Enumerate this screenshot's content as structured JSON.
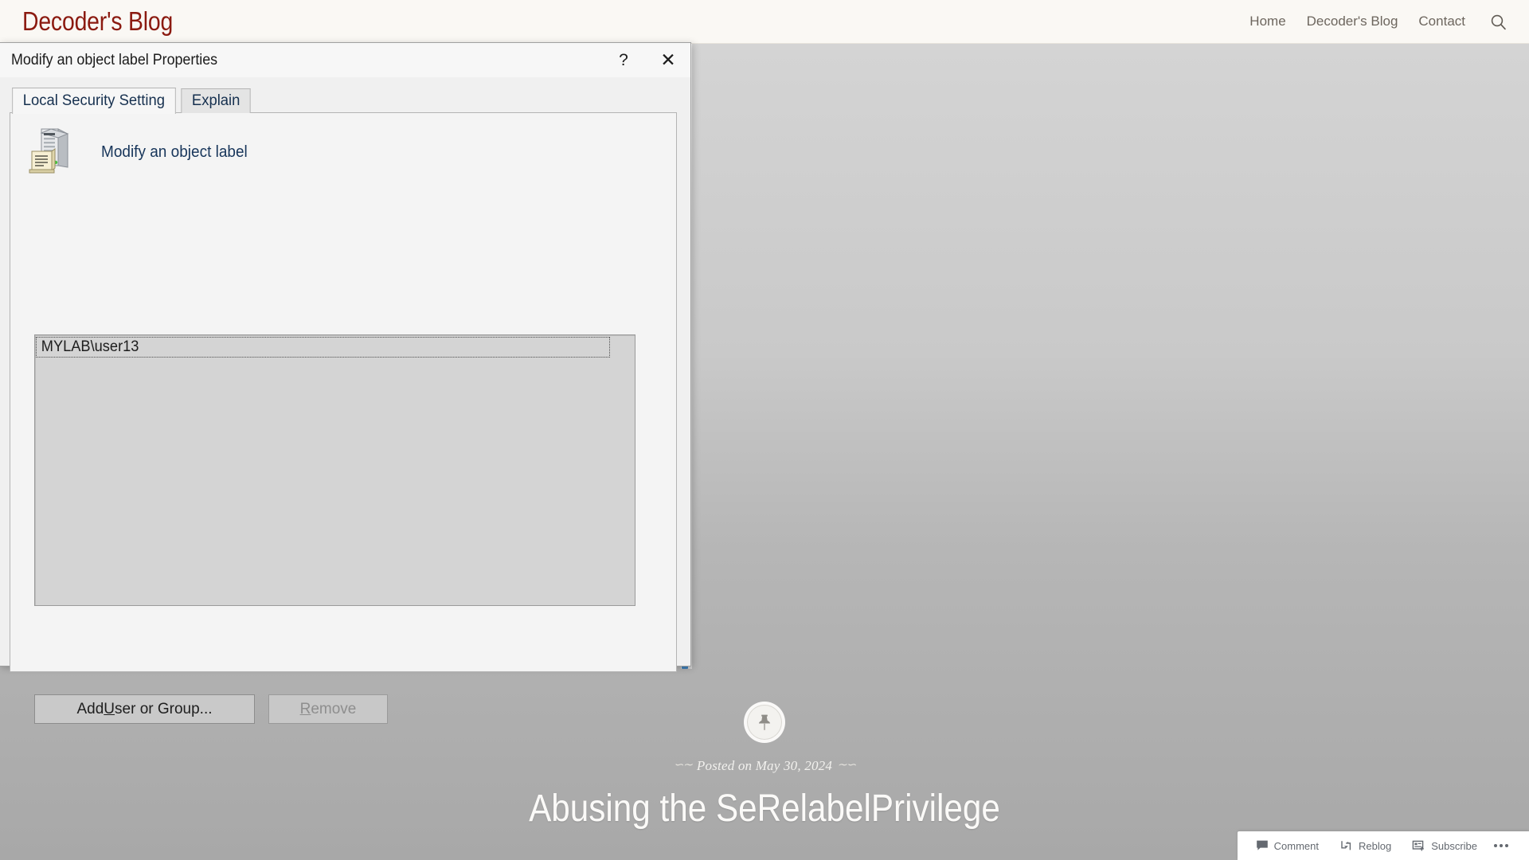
{
  "site": {
    "title": "Decoder's Blog",
    "brand_color": "#8b1a10",
    "nav": [
      {
        "label": "Home",
        "name": "nav-home"
      },
      {
        "label": "Decoder's Blog",
        "name": "nav-decoders-blog"
      },
      {
        "label": "Contact",
        "name": "nav-contact"
      }
    ],
    "search_icon": "search-icon"
  },
  "post": {
    "badge_icon": "pin-icon",
    "date_prefix": "Posted on",
    "date": "May 30, 2024",
    "date_full": "Posted on May 30, 2024",
    "title": "Abusing the SeRelabelPrivilege"
  },
  "actionbar": {
    "items": [
      {
        "label": "Comment",
        "icon": "comment-icon",
        "name": "comment-button"
      },
      {
        "label": "Reblog",
        "icon": "reblog-icon",
        "name": "reblog-button"
      },
      {
        "label": "Subscribe",
        "icon": "subscribe-icon",
        "name": "subscribe-button"
      }
    ],
    "more_label": "More options"
  },
  "dialog": {
    "title": "Modify an object label Properties",
    "help_glyph": "?",
    "close_glyph": "✕",
    "tabs": [
      {
        "label": "Local Security Setting",
        "name": "tab-local-security-setting",
        "active": true
      },
      {
        "label": "Explain",
        "name": "tab-explain",
        "active": false
      }
    ],
    "policy_icon": "policy-server-document-icon",
    "policy_name": "Modify an object label",
    "listbox": {
      "items": [
        {
          "text": "MYLAB\\user13",
          "selected": true,
          "focused": true
        }
      ]
    },
    "buttons": {
      "add": {
        "pre": "Add ",
        "accel": "U",
        "post": "ser or Group...",
        "full": "Add User or Group...",
        "enabled": true
      },
      "remove": {
        "pre": "",
        "accel": "R",
        "post": "emove",
        "full": "Remove",
        "enabled": false
      }
    }
  }
}
